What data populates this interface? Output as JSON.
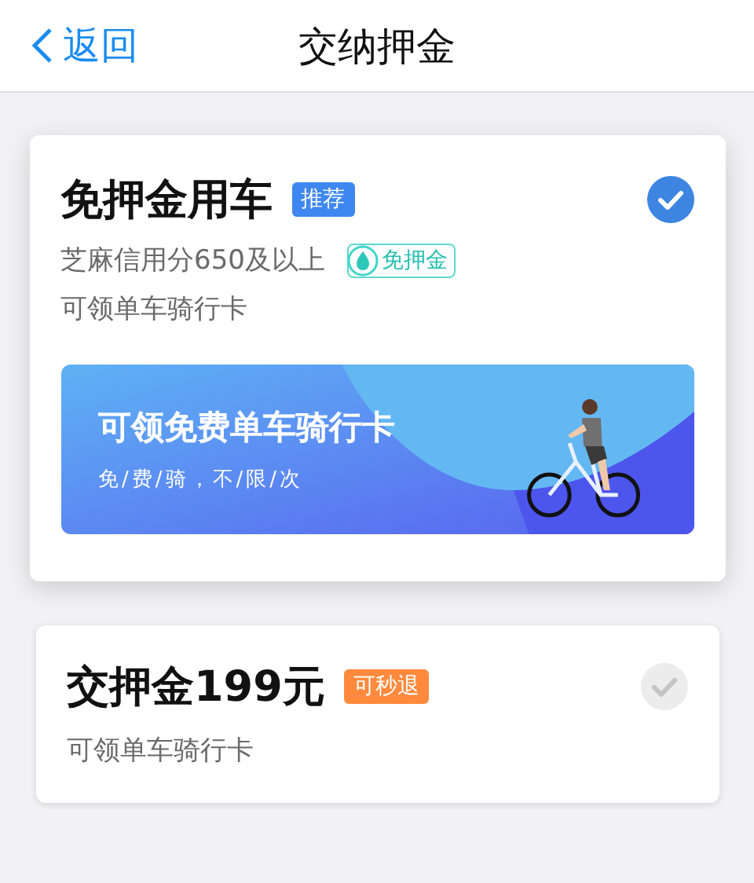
{
  "nav": {
    "back": "返回",
    "title": "交纳押金"
  },
  "options": [
    {
      "title": "免押金用车",
      "tag": {
        "text": "推荐",
        "color": "#3f87f0"
      },
      "credit": {
        "text": "芝麻信用分650及以上",
        "badge": "免押金"
      },
      "note": "可领单车骑行卡",
      "banner": {
        "kind": "picture",
        "title": "可领免费单车骑行卡",
        "subtitle": "免/费/骑，不/限/次"
      },
      "selected": true
    },
    {
      "title": "交押金199元",
      "tag": {
        "text": "可秒退",
        "color": "#ff8a3d"
      },
      "note": "可领单车骑行卡",
      "selected": false
    }
  ]
}
